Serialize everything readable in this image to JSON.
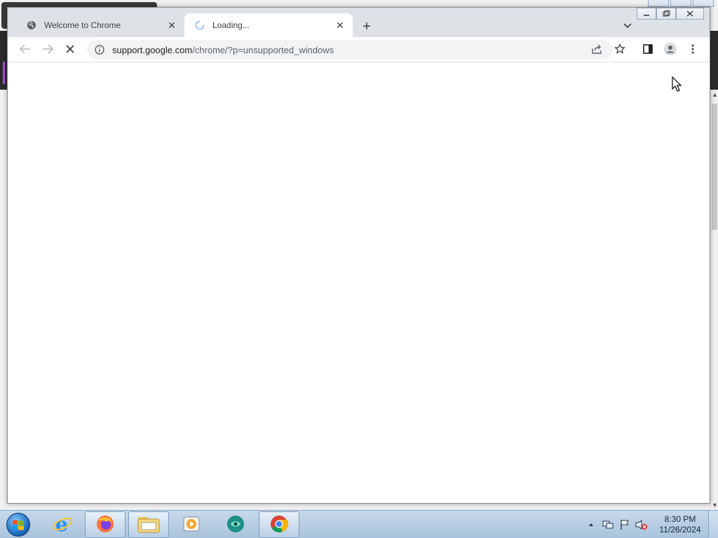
{
  "chrome": {
    "tabs": [
      {
        "title": "Welcome to Chrome",
        "state": "inactive",
        "icon": "globe-icon"
      },
      {
        "title": "Loading...",
        "state": "active",
        "icon": "spinner-icon"
      }
    ],
    "new_tab_symbol": "+",
    "close_symbol": "✕",
    "omnibox": {
      "url_host": "support.google.com",
      "url_path": "/chrome/?p=unsupported_windows"
    }
  },
  "taskbar": {
    "apps": [
      {
        "name": "internet-explorer",
        "icon": "ie-icon",
        "active": false
      },
      {
        "name": "firefox",
        "icon": "firefox-icon",
        "active": true
      },
      {
        "name": "file-explorer",
        "icon": "folder-icon",
        "active": true
      },
      {
        "name": "media-player",
        "icon": "media-icon",
        "active": false
      },
      {
        "name": "app-teal",
        "icon": "teal-app-icon",
        "active": false
      },
      {
        "name": "chrome",
        "icon": "chrome-icon",
        "active": true
      }
    ],
    "clock": {
      "time": "8:30 PM",
      "date": "11/26/2024"
    }
  },
  "colors": {
    "tabstrip": "#dee1e6",
    "omnibox": "#f1f3f4",
    "taskbar": "#b9cfe6"
  }
}
